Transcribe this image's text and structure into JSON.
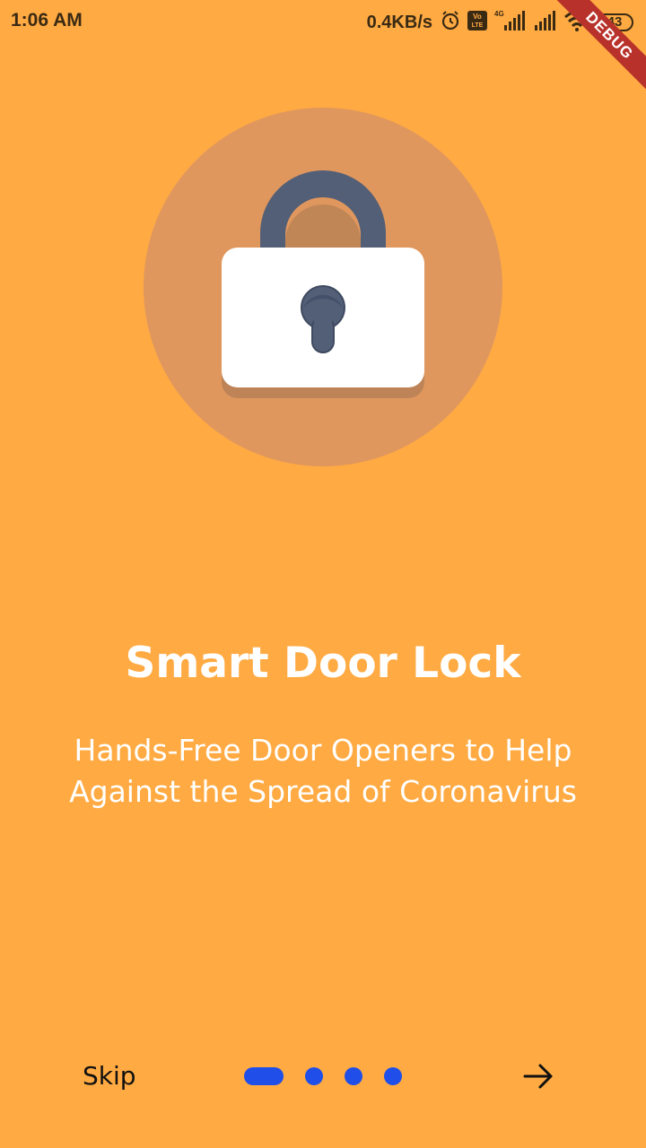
{
  "status_bar": {
    "time": "1:06 AM",
    "network_speed": "0.4KB/s",
    "volte_label": "Vo LTE",
    "network_type": "4G",
    "battery": "43"
  },
  "debug_banner": "DEBUG",
  "onboarding": {
    "title": "Smart Door Lock",
    "subtitle_line1": "Hands-Free Door Openers to Help",
    "subtitle_line2": "Against the Spread of Coronavirus"
  },
  "footer": {
    "skip_label": "Skip",
    "page_count": 4,
    "current_page": 1
  },
  "colors": {
    "background": "#FFAA42",
    "circle": "#E0975E",
    "dot_accent": "#1F4FE8",
    "shackle": "#525F77",
    "lock_body": "#FFFFFF",
    "debug_ribbon": "#B8322B"
  },
  "icons": {
    "illustration": "padlock-icon",
    "next": "arrow-right-icon",
    "alarm": "alarm-icon",
    "signal": "signal-icon",
    "wifi": "wifi-icon",
    "battery": "battery-icon"
  }
}
